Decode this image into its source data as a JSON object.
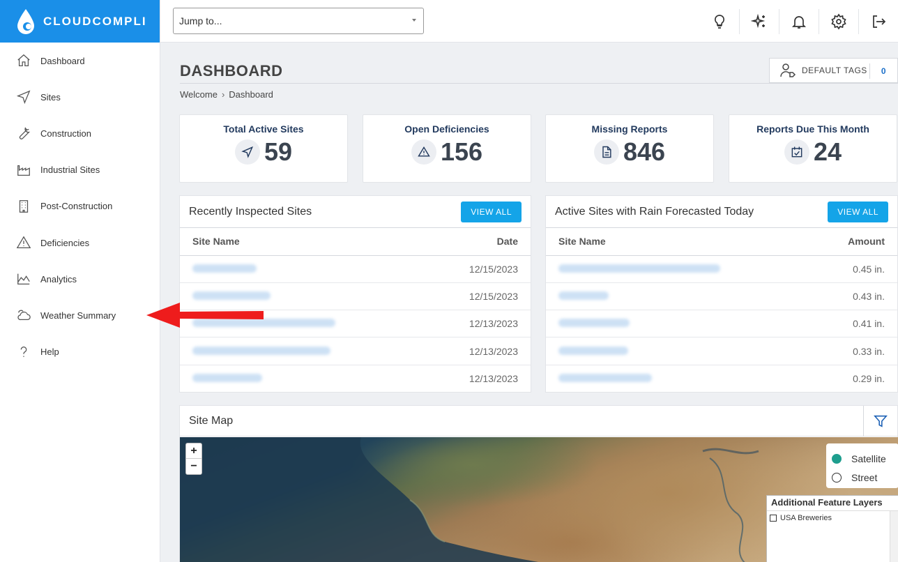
{
  "brand": {
    "name": "CLOUDCOMPLI"
  },
  "sidebar": {
    "items": [
      {
        "label": "Dashboard",
        "icon": "home-icon"
      },
      {
        "label": "Sites",
        "icon": "navigation-arrow-icon"
      },
      {
        "label": "Construction",
        "icon": "wrench-icon"
      },
      {
        "label": "Industrial Sites",
        "icon": "factory-icon"
      },
      {
        "label": "Post-Construction",
        "icon": "building-icon"
      },
      {
        "label": "Deficiencies",
        "icon": "warning-triangle-icon"
      },
      {
        "label": "Analytics",
        "icon": "area-chart-icon"
      },
      {
        "label": "Weather Summary",
        "icon": "cloud-icon"
      },
      {
        "label": "Help",
        "icon": "question-icon"
      }
    ]
  },
  "topbar": {
    "jump_placeholder": "Jump to...",
    "icons": [
      "lightbulb-icon",
      "sparkles-icon",
      "bell-icon",
      "gear-icon",
      "logout-icon"
    ]
  },
  "page": {
    "title": "DASHBOARD",
    "breadcrumb": [
      "Welcome",
      "Dashboard"
    ],
    "breadcrumb_sep": "›",
    "default_tags_label": "DEFAULT TAGS",
    "default_tags_count": "0"
  },
  "stats": [
    {
      "label": "Total Active Sites",
      "value": "59",
      "icon": "navigation-arrow-icon"
    },
    {
      "label": "Open Deficiencies",
      "value": "156",
      "icon": "warning-triangle-icon"
    },
    {
      "label": "Missing Reports",
      "value": "846",
      "icon": "document-icon"
    },
    {
      "label": "Reports Due This Month",
      "value": "24",
      "icon": "calendar-check-icon"
    }
  ],
  "recent": {
    "title": "Recently Inspected Sites",
    "view_all": "VIEW ALL",
    "col_site": "Site Name",
    "col_date": "Date",
    "rows": [
      {
        "date": "12/15/2023"
      },
      {
        "date": "12/15/2023"
      },
      {
        "date": "12/13/2023"
      },
      {
        "date": "12/13/2023"
      },
      {
        "date": "12/13/2023"
      }
    ]
  },
  "rain": {
    "title": "Active Sites with Rain Forecasted Today",
    "view_all": "VIEW ALL",
    "col_site": "Site Name",
    "col_amount": "Amount",
    "rows": [
      {
        "amount": "0.45 in."
      },
      {
        "amount": "0.43 in."
      },
      {
        "amount": "0.41 in."
      },
      {
        "amount": "0.33 in."
      },
      {
        "amount": "0.29 in."
      }
    ]
  },
  "map": {
    "title": "Site Map",
    "zoom_in": "+",
    "zoom_out": "−",
    "layers": [
      {
        "label": "Satellite",
        "selected": true
      },
      {
        "label": "Street",
        "selected": false
      }
    ],
    "features_title": "Additional Feature Layers",
    "features": [
      {
        "label": "USA Breweries",
        "checked": false
      }
    ]
  },
  "colors": {
    "brand": "#1a8fe8",
    "accent_button": "#14a4e8",
    "annotation_arrow": "#ee1c1c"
  }
}
